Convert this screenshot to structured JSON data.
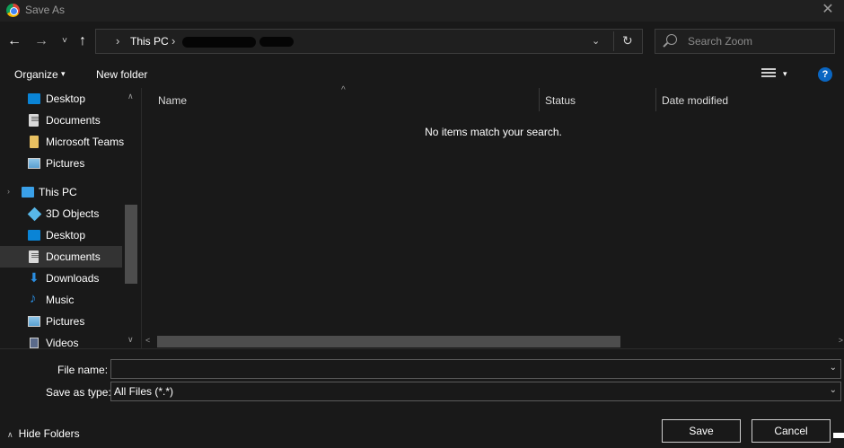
{
  "window": {
    "title": "Save As",
    "close_icon": "close-icon"
  },
  "nav": {
    "back_icon": "←",
    "forward_icon": "→",
    "recent_icon": "˅",
    "up_icon": "↑",
    "address": {
      "segment_1": "This PC",
      "chev": "›",
      "dropdown_icon": "⌄",
      "refresh_icon": "↻"
    },
    "search_placeholder": "Search Zoom"
  },
  "toolbar": {
    "organize_label": "Organize",
    "organize_caret": "▾",
    "new_folder_label": "New folder",
    "view_caret": "▾",
    "help_label": "?"
  },
  "sidebar": {
    "items": [
      {
        "label": "Desktop",
        "icon": "desktop-icon"
      },
      {
        "label": "Documents",
        "icon": "documents-icon"
      },
      {
        "label": "Microsoft Teams",
        "icon": "folder-icon"
      },
      {
        "label": "Pictures",
        "icon": "pictures-icon"
      },
      {
        "label": "This PC",
        "icon": "this-pc-icon"
      },
      {
        "label": "3D Objects",
        "icon": "3d-objects-icon"
      },
      {
        "label": "Desktop",
        "icon": "desktop-icon"
      },
      {
        "label": "Documents",
        "icon": "documents-icon",
        "selected": true
      },
      {
        "label": "Downloads",
        "icon": "downloads-icon"
      },
      {
        "label": "Music",
        "icon": "music-icon"
      },
      {
        "label": "Pictures",
        "icon": "pictures-icon"
      },
      {
        "label": "Videos",
        "icon": "videos-icon"
      }
    ],
    "this_pc_chevron": "›",
    "scroll_up": "∧",
    "scroll_down": "∨"
  },
  "columns": {
    "name": "Name",
    "status": "Status",
    "date_modified": "Date modified",
    "sort_arrow": "^"
  },
  "empty_message": "No items match your search.",
  "hscroll": {
    "left": "<",
    "right": ">"
  },
  "form": {
    "file_name_label": "File name:",
    "file_name_value": "",
    "save_as_type_label": "Save as type:",
    "save_as_type_value": "All Files (*.*)",
    "caret": "⌄"
  },
  "footer": {
    "hide_folders_caret": "∧",
    "hide_folders_label": "Hide Folders",
    "save_label": "Save",
    "cancel_label": "Cancel"
  },
  "colors": {
    "background": "#191919",
    "titlebar": "#202020",
    "selected": "#333333",
    "accent": "#0a66c2"
  }
}
